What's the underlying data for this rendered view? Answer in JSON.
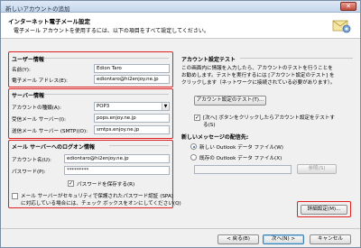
{
  "window": {
    "title": "新しいアカウントの追加",
    "close_glyph": "✕"
  },
  "header": {
    "title": "インターネット電子メール設定",
    "subtitle": "電子メール アカウントを使用するには、以下の項目をすべて設定してください。"
  },
  "user_info": {
    "heading": "ユーザー情報",
    "name_label": "名前(Y):",
    "name_value": "Edion Taro",
    "email_label": "電子メール アドレス(E):",
    "email_value": "ediontaro@hi2enjoy.ne.jp"
  },
  "server_info": {
    "heading": "サーバー情報",
    "account_type_label": "アカウントの種類(A):",
    "account_type_value": "POP3",
    "incoming_label": "受信メール サーバー(I):",
    "incoming_value": "pops.enjoy.ne.jp",
    "outgoing_label": "送信メール サーバー (SMTP)(O):",
    "outgoing_value": "smtps.enjoy.ne.jp"
  },
  "logon_info": {
    "heading": "メール サーバーへのログオン情報",
    "account_label": "アカウント名(U):",
    "account_value": "ediontaro@hi2enjoy.ne.jp",
    "password_label": "パスワード(P):",
    "password_value": "*********",
    "remember_label": "パスワードを保存する(R)",
    "spa_line1": "メール サーバーがセキュリティで保護されたパスワード認証 (SPA)",
    "spa_line2": "に対応している場合には、チェック ボックスをオンにしてください(Q)"
  },
  "test": {
    "heading": "アカウント設定テスト",
    "desc_line1": "この画面内に情報を入力したら、アカウントのテストを行うことを",
    "desc_line2": "お勧めします。テストを実行するには [アカウント設定のテスト] を",
    "desc_line3": "クリックします（ネットワークに接続されている必要があります）。",
    "test_button": "アカウント設定のテスト(T)...",
    "next_check_line1": "[次へ] ボタンをクリックしたらアカウント設定をテストす",
    "next_check_line2": "る(S)"
  },
  "delivery": {
    "heading": "新しいメッセージの配信先:",
    "new_file": "新しい Outlook データ ファイル(W)",
    "existing_file": "既存の Outlook データ ファイル(X)",
    "browse_button": "参照(S)"
  },
  "more_settings_button": "詳細設定(M)...",
  "footer": {
    "back_button": "< 戻る(B)",
    "next_button": "次へ(N) >",
    "cancel_button": "キャンセル"
  }
}
